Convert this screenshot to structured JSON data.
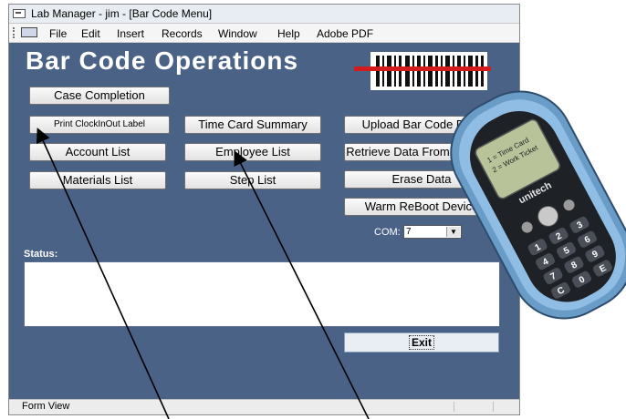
{
  "window": {
    "title": "Lab Manager - jim - [Bar Code Menu]"
  },
  "menu": {
    "items": [
      "File",
      "Edit",
      "Insert",
      "Records",
      "Window",
      "Help",
      "Adobe PDF"
    ]
  },
  "form": {
    "heading": "Bar Code Operations",
    "buttons": {
      "case_completion": "Case Completion",
      "print_clock": "Print ClockInOut Label",
      "time_card_summary": "Time Card Summary",
      "upload_bar_code": "Upload Bar Code Data",
      "account_list": "Account List",
      "employee_list": "Employee List",
      "retrieve_data": "Retrieve Data From Scanner",
      "materials_list": "Materials List",
      "step_list": "Step List",
      "erase_data": "Erase Data",
      "warm_reboot": "Warm ReBoot Device"
    },
    "com_label": "COM:",
    "com_value": "7",
    "status_label": "Status:",
    "exit_label": "Exit"
  },
  "statusbar": {
    "text": "Form View"
  },
  "device": {
    "brand": "unitech",
    "screen_lines": [
      "1 = Time Card",
      "2 = Work Ticket"
    ],
    "keys": [
      "1",
      "2",
      "3",
      "4",
      "5",
      "6",
      "7",
      "8",
      "9",
      "C",
      "0",
      "E"
    ]
  },
  "colors": {
    "form_background": "#4b6287",
    "barcode_line": "#d31b1b"
  }
}
